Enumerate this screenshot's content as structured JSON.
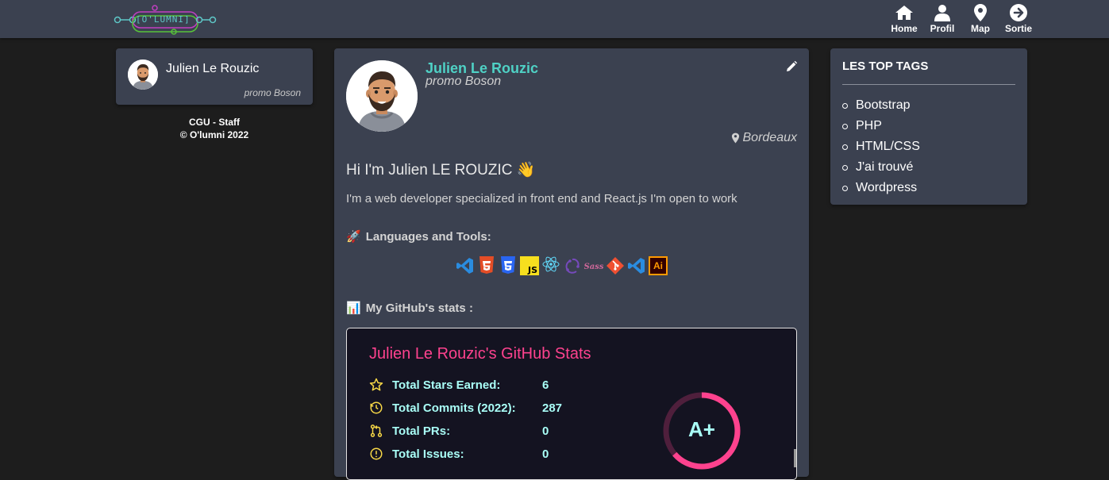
{
  "header": {
    "logo_text": "[O'LUMNI]",
    "nav": [
      {
        "label": "Home",
        "icon": "home-icon"
      },
      {
        "label": "Profil",
        "icon": "user-icon"
      },
      {
        "label": "Map",
        "icon": "map-marker-icon"
      },
      {
        "label": "Sortie",
        "icon": "arrow-right-circle-icon"
      }
    ]
  },
  "sidebar_left": {
    "name": "Julien Le Rouzic",
    "promo": "promo Boson",
    "footer_line1": "CGU - Staff",
    "footer_line2": "© O'lumni 2022"
  },
  "profile": {
    "name": "Julien Le Rouzic",
    "promo": "promo Boson",
    "location": "Bordeaux",
    "greeting": "Hi I'm Julien LE ROUZIC 👋",
    "intro": "I'm a web developer specialized in front end and React.js I'm open to work",
    "languages_title": "Languages and Tools:",
    "github_title": "My GitHub's stats :",
    "tools": [
      "vscode",
      "html5",
      "css3",
      "javascript",
      "react",
      "redux",
      "sass",
      "git",
      "vscode",
      "illustrator"
    ]
  },
  "github_stats": {
    "title": "Julien Le Rouzic's GitHub Stats",
    "rows": [
      {
        "label": "Total Stars Earned:",
        "value": "6",
        "icon": "star-icon"
      },
      {
        "label": "Total Commits (2022):",
        "value": "287",
        "icon": "clock-icon"
      },
      {
        "label": "Total PRs:",
        "value": "0",
        "icon": "pull-request-icon"
      },
      {
        "label": "Total Issues:",
        "value": "0",
        "icon": "issue-icon"
      }
    ],
    "grade": "A+",
    "colors": {
      "title": "#fe428e",
      "text": "#a9fef7",
      "icon": "#f8d847",
      "bg": "#141321",
      "ring": "#fe428e"
    }
  },
  "top_tags": {
    "title": "LES TOP TAGS",
    "items": [
      "Bootstrap",
      "PHP",
      "HTML/CSS",
      "J'ai trouvé",
      "Wordpress"
    ]
  },
  "colors": {
    "accent": "#4fd1c5",
    "card": "#3b4150",
    "background": "#1d1d1d"
  }
}
